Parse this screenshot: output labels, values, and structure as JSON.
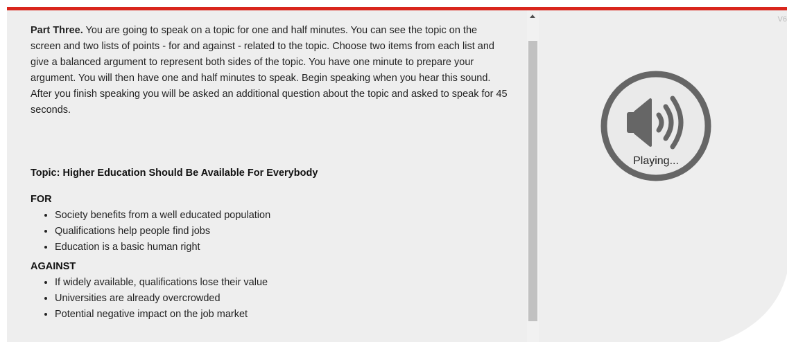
{
  "instructions": {
    "heading": "Part Three.",
    "body": " You are going to speak on a topic for one and half minutes. You can see the topic on the screen and two lists of points - for and against - related to the topic. Choose two items from each list and give a balanced argument to represent both sides of the topic. You have one minute to prepare your argument. You will then have one and half minutes to speak. Begin speaking when you hear this sound. After you finish speaking you will be asked an additional question about the topic and asked to speak for 45 seconds."
  },
  "topic": "Topic: Higher Education Should Be Available For Everybody",
  "for_list": {
    "heading": "FOR",
    "items": [
      "Society benefits from a well educated population",
      "Qualifications help people find jobs",
      "Education is a basic human right"
    ]
  },
  "against_list": {
    "heading": "AGAINST",
    "items": [
      "If widely available, qualifications lose their value",
      "Universities are already overcrowded",
      "Potential negative impact on the job market"
    ]
  },
  "audio_status": {
    "icon": "speaker-icon",
    "label": "Playing..."
  },
  "version": "V6",
  "colors": {
    "accent_bar": "#d9261c",
    "panel_bg": "#eeeeee",
    "icon_gray": "#666666"
  }
}
